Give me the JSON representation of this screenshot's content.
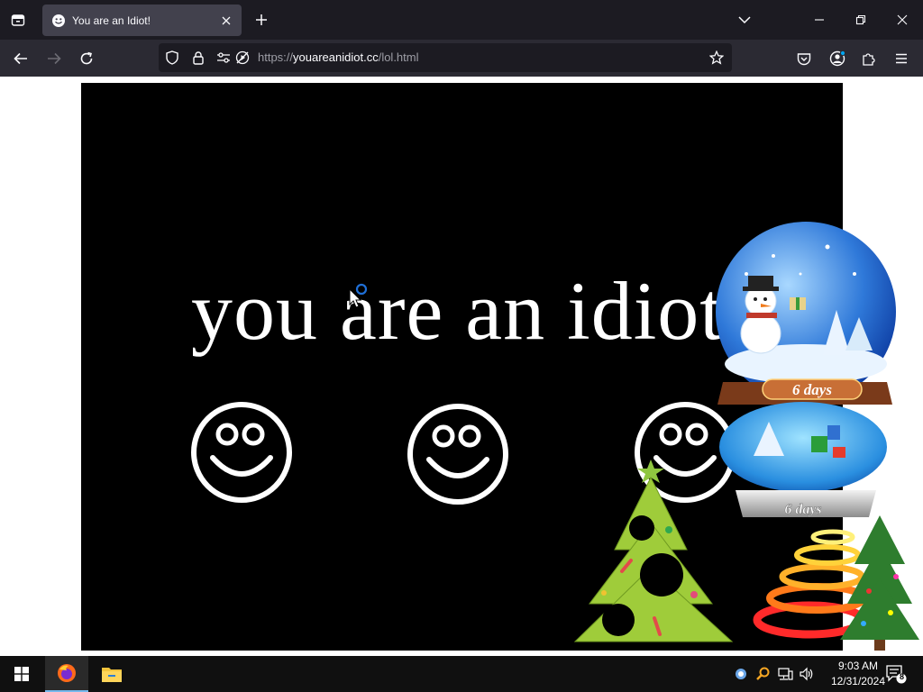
{
  "browser": {
    "tab": {
      "title": "You are an Idiot!",
      "favicon": "smiley-icon"
    },
    "url": {
      "scheme": "https://",
      "host": "youareanidiot.cc",
      "path": "/lol.html"
    }
  },
  "page": {
    "headline": "you are an idiot",
    "smileys": [
      "smiley-icon",
      "smiley-icon",
      "smiley-icon"
    ],
    "globe_banner_top": "6 days",
    "globe_banner_base": "6 days"
  },
  "taskbar": {
    "time": "9:03 AM",
    "date": "12/31/2024",
    "notification_count": "8"
  },
  "colors": {
    "tabbar_bg": "#1c1b22",
    "navbar_bg": "#2b2a33",
    "stage_bg": "#000000",
    "headline_color": "#ffffff",
    "taskbar_bg": "#101010"
  }
}
